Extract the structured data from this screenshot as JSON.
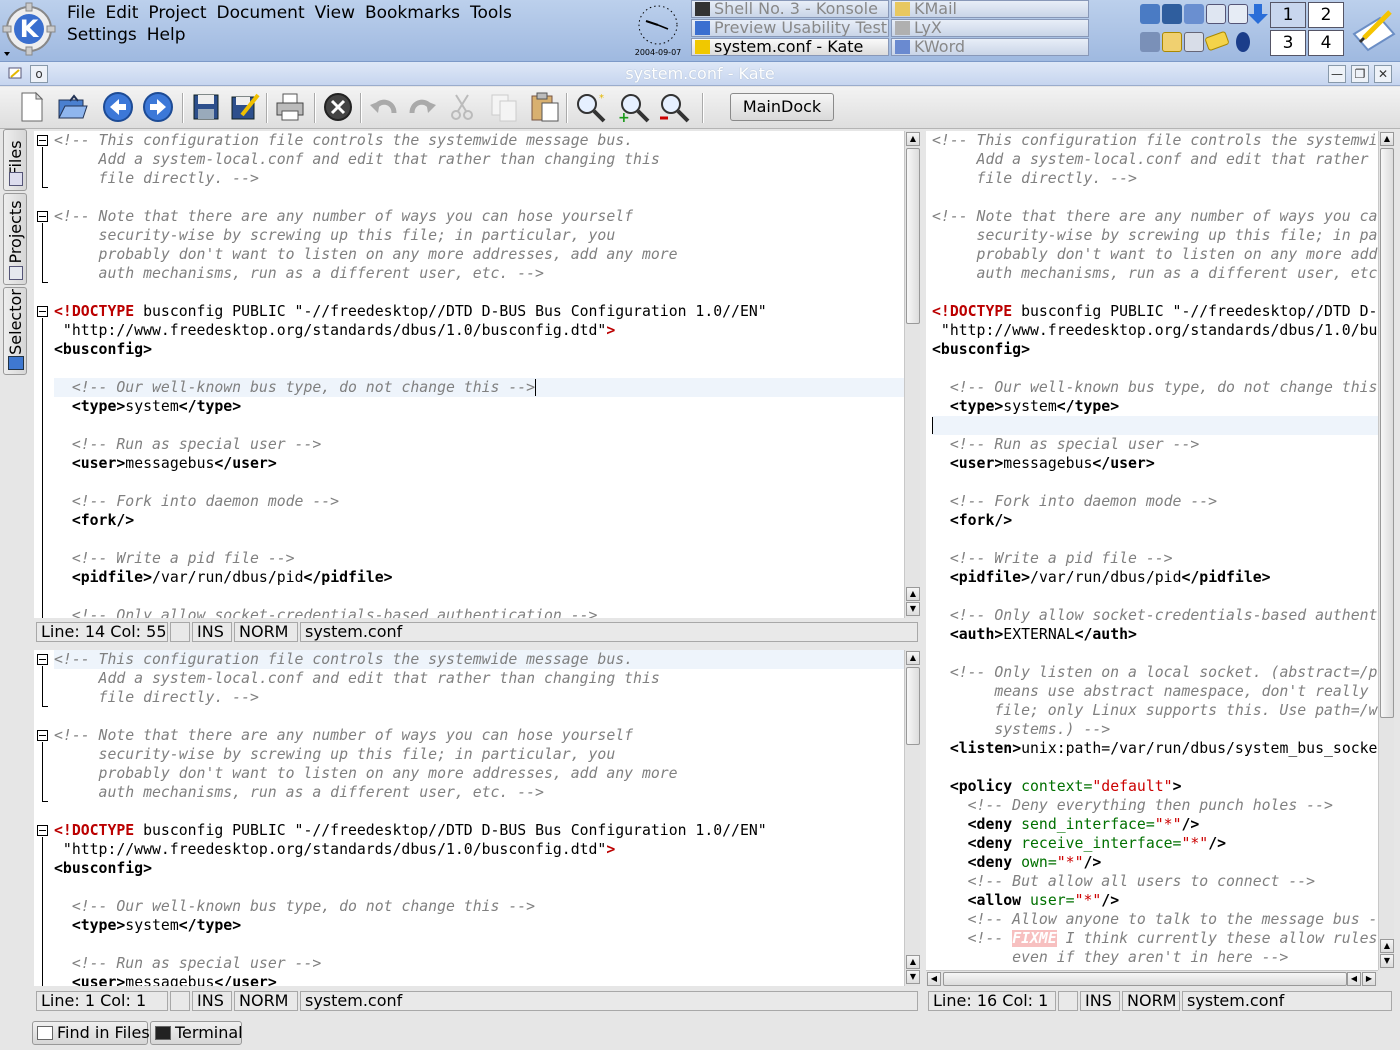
{
  "panel": {
    "menus": [
      "File",
      "Edit",
      "Project",
      "Document",
      "View",
      "Bookmarks",
      "Tools",
      "Settings",
      "Help"
    ],
    "clock_date": "2004-09-07",
    "tasks": [
      {
        "label": "Shell No. 3 - Konsole",
        "active": false,
        "icon": "konsole-icon"
      },
      {
        "label": "KMail",
        "active": false,
        "icon": "kmail-icon"
      },
      {
        "label": "Preview Usability Test",
        "active": false,
        "icon": "browser-icon"
      },
      {
        "label": "LyX",
        "active": false,
        "icon": "lyx-icon"
      },
      {
        "label": "system.conf - Kate",
        "active": true,
        "icon": "kate-icon"
      },
      {
        "label": "KWord",
        "active": false,
        "icon": "kword-icon"
      }
    ],
    "pager": [
      "1",
      "2",
      "3",
      "4"
    ]
  },
  "window": {
    "title": "system.conf - Kate"
  },
  "toolbar": {
    "maindock_label": "MainDock"
  },
  "sidetabs": {
    "files": "Files",
    "projects": "Projects",
    "selector": "Selector"
  },
  "views": {
    "top_left": {
      "line_col": "Line: 14 Col: 55",
      "ins": "INS",
      "norm": "NORM",
      "file": "system.conf"
    },
    "bottom_left": {
      "line_col": "Line: 1 Col: 1",
      "ins": "INS",
      "norm": "NORM",
      "file": "system.conf"
    },
    "right": {
      "line_col": "Line: 16 Col: 1",
      "ins": "INS",
      "norm": "NORM",
      "file": "system.conf"
    }
  },
  "code_lines": [
    "<!-- This configuration file controls the systemwide message bus.",
    "     Add a system-local.conf and edit that rather than changing this",
    "     file directly. -->",
    "",
    "<!-- Note that there are any number of ways you can hose yourself",
    "     security-wise by screwing up this file; in particular, you",
    "     probably don't want to listen on any more addresses, add any more",
    "     auth mechanisms, run as a different user, etc. -->",
    "",
    "<!DOCTYPE busconfig PUBLIC \"-//freedesktop//DTD D-BUS Bus Configuration 1.0//EN\"",
    " \"http://www.freedesktop.org/standards/dbus/1.0/busconfig.dtd\">",
    "<busconfig>",
    "",
    "  <!-- Our well-known bus type, do not change this -->",
    "  <type>system</type>",
    "",
    "  <!-- Run as special user -->",
    "  <user>messagebus</user>",
    "",
    "  <!-- Fork into daemon mode -->",
    "  <fork/>",
    "",
    "  <!-- Write a pid file -->",
    "  <pidfile>/var/run/dbus/pid</pidfile>",
    "",
    "  <!-- Only allow socket-credentials-based authentication -->",
    "  <auth>EXTERNAL</auth>",
    "",
    "  <!-- Only listen on a local socket. (abstract=/path/to/socket",
    "       means use abstract namespace, don't really create filesystem",
    "       file; only Linux supports this. Use path=/whatever on other",
    "       systems.) -->",
    "  <listen>unix:path=/var/run/dbus/system_bus_socket</listen>",
    "",
    "  <policy context=\"default\">",
    "    <!-- Deny everything then punch holes -->",
    "    <deny send_interface=\"*\"/>",
    "    <deny receive_interface=\"*\"/>",
    "    <deny own=\"*\"/>",
    "    <!-- But allow all users to connect -->",
    "    <allow user=\"*\"/>",
    "    <!-- Allow anyone to talk to the message bus -->",
    "    <!-- FIXME I think currently these allow rules are always implicit",
    "         even if they aren't in here -->"
  ],
  "bottom_tabs": {
    "find": "Find in Files",
    "terminal": "Terminal"
  }
}
